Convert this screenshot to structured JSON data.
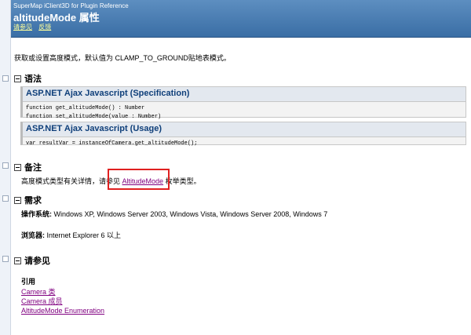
{
  "header": {
    "subtitle": "SuperMap iClient3D for Plugin Reference",
    "title": "altitudeMode 属性",
    "links": [
      "请参见",
      "反馈"
    ]
  },
  "summary": "获取或设置高度模式，默认值为 CLAMP_TO_GROUND贴地表模式。",
  "syntax": {
    "heading": "语法",
    "spec": {
      "title": "ASP.NET Ajax Javascript (Specification)",
      "lines": [
        "function get_altitudeMode() : Number",
        "function set_altitudeMode(value : Number)"
      ]
    },
    "usage": {
      "title": "ASP.NET Ajax Javascript (Usage)",
      "lines": [
        "var resultVar = instanceOfCamera.get_altitudeMode();"
      ]
    }
  },
  "remarks": {
    "heading": "备注",
    "text_before": "高度模式类型有关详情，请参见",
    "link": "AltitudeMode",
    "text_after": " 枚举类型。"
  },
  "requirements": {
    "heading": "需求",
    "os_label": "操作系统:",
    "os_value": " Windows XP, Windows Server 2003, Windows Vista, Windows Server 2008, Windows 7",
    "browser_label": "浏览器:",
    "browser_value": " Internet Explorer 6 以上"
  },
  "see_also": {
    "heading": "请参见",
    "subheading": "引用",
    "links": [
      "Camera 类",
      "Camera 成员",
      "AltitudeMode Enumeration"
    ]
  },
  "colors": {
    "header_bg": "#3a6ea5",
    "link": "#800080",
    "code_title": "#0f3f7a",
    "highlight": "#e02020"
  }
}
